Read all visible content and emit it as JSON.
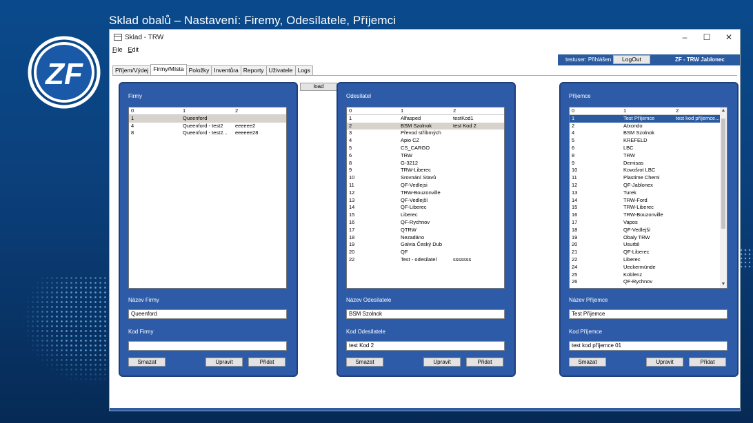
{
  "slide_title": "Sklad obalů – Nastavení: Firemy, Odesílatele, Příjemci",
  "logo_text": "ZF",
  "window": {
    "title": "Sklad - TRW",
    "controls": {
      "minimize": "–",
      "maximize": "☐",
      "close": "✕"
    }
  },
  "menu": [
    {
      "label": "File",
      "hotkey": "F"
    },
    {
      "label": "Edit",
      "hotkey": "E"
    }
  ],
  "status": {
    "user": "testuser: Přihlášen",
    "logout": "LogOut",
    "company": "ZF - TRW Jablonec"
  },
  "tabs": [
    "Příjem/Výdej",
    "Firmy/Místa",
    "Položky",
    "Inventůra",
    "Reporty",
    "Uživatele",
    "Logs"
  ],
  "active_tab": 1,
  "load_button": "load",
  "firmy": {
    "title": "Firmy",
    "columns": [
      "0",
      "1",
      "2"
    ],
    "rows": [
      [
        "1",
        "Queenford",
        ""
      ],
      [
        "4",
        "Queenford - test2",
        "eeeeee2"
      ],
      [
        "8",
        "Queenford - test2...",
        "eeeeee28"
      ]
    ],
    "selected_index": 0,
    "name_label": "Název Firmy",
    "name_value": "Queenford",
    "code_label": "Kod Firmy",
    "code_value": "",
    "delete": "Smazat",
    "edit": "Upravit",
    "add": "Přidat"
  },
  "odesilatel": {
    "title": "Odesílatel",
    "columns": [
      "0",
      "1",
      "2"
    ],
    "rows": [
      [
        "1",
        "Alfasped",
        "testKod1"
      ],
      [
        "2",
        "BSM Szolnok",
        "test Kod 2"
      ],
      [
        "3",
        "Převod stříbrných",
        ""
      ],
      [
        "4",
        "Apio CZ",
        ""
      ],
      [
        "5",
        "CS_CARGO",
        ""
      ],
      [
        "6",
        "TRW",
        ""
      ],
      [
        "8",
        "G-3212",
        ""
      ],
      [
        "9",
        "TRW-Liberec",
        ""
      ],
      [
        "10",
        "Srovnání Stavů",
        ""
      ],
      [
        "11",
        "QF-Vedlejsi",
        ""
      ],
      [
        "12",
        "TRW-Bouzonville",
        ""
      ],
      [
        "13",
        "QF-Vedlejší",
        ""
      ],
      [
        "14",
        "QF-Liberec",
        ""
      ],
      [
        "15",
        "Liberec",
        ""
      ],
      [
        "16",
        "QF-Rychnov",
        ""
      ],
      [
        "17",
        "QTRW",
        ""
      ],
      [
        "18",
        "Nezadáno",
        ""
      ],
      [
        "19",
        "Galvia Český Dub",
        ""
      ],
      [
        "20",
        "QF",
        ""
      ],
      [
        "22",
        "Test - odesilatel",
        "sssssss"
      ]
    ],
    "selected_index": 1,
    "name_label": "Název Odesílatele",
    "name_value": "BSM Szolnok",
    "code_label": "Kod Odesílatele",
    "code_value": "test Kod 2",
    "delete": "Smazat",
    "edit": "Upravit",
    "add": "Přidat"
  },
  "prijemce": {
    "title": "Příjemce",
    "columns": [
      "0",
      "1",
      "2"
    ],
    "rows": [
      [
        "1",
        "Test Příjemce",
        "test kod příjemce..."
      ],
      [
        "2",
        "Atxondo",
        ""
      ],
      [
        "4",
        "BSM Szolnok",
        ""
      ],
      [
        "5",
        "KREFELD",
        ""
      ],
      [
        "6",
        "LBC",
        ""
      ],
      [
        "8",
        "TRW",
        ""
      ],
      [
        "9",
        "Demisas",
        ""
      ],
      [
        "10",
        "Kovošrot LBC",
        ""
      ],
      [
        "11",
        "Plastime Chemi",
        ""
      ],
      [
        "12",
        "QF-Jablonex",
        ""
      ],
      [
        "13",
        "Turek",
        ""
      ],
      [
        "14",
        "TRW-Ford",
        ""
      ],
      [
        "15",
        "TRW-Liberec",
        ""
      ],
      [
        "16",
        "TRW-Bouzonville",
        ""
      ],
      [
        "17",
        "Vapos",
        ""
      ],
      [
        "18",
        "QF-Vedlejší",
        ""
      ],
      [
        "19",
        "Obaly TRW",
        ""
      ],
      [
        "20",
        "Usurbil",
        ""
      ],
      [
        "21",
        "QF-Liberec",
        ""
      ],
      [
        "22",
        "Liberec",
        ""
      ],
      [
        "24",
        "Ueckermünde",
        ""
      ],
      [
        "25",
        "Koblenz",
        ""
      ],
      [
        "26",
        "QF-Rychnov",
        ""
      ]
    ],
    "selected_index": 0,
    "name_label": "Název Příjemce",
    "name_value": "Test Příjemce",
    "code_label": "Kod Příjemce",
    "code_value": "test kod příjemce 01",
    "delete": "Smazat",
    "edit": "Upravit",
    "add": "Přidat"
  }
}
